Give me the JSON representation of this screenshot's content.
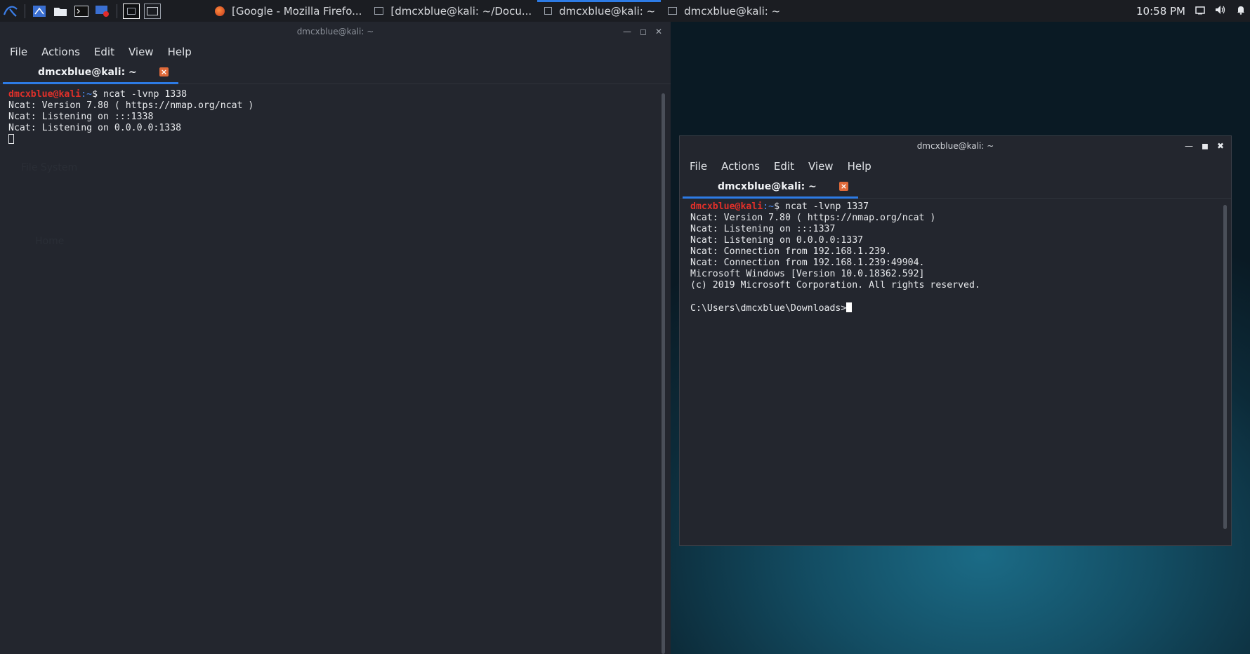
{
  "taskbar": {
    "tasks": [
      {
        "label": "[Google - Mozilla Firefo...",
        "icon": "firefox-icon"
      },
      {
        "label": "[dmcxblue@kali: ~/Docu...",
        "icon": "terminal-window-icon"
      },
      {
        "label": "dmcxblue@kali: ~",
        "icon": "terminal-window-icon",
        "active": true
      },
      {
        "label": "dmcxblue@kali: ~",
        "icon": "terminal-window-icon"
      }
    ],
    "clock": "10:58 PM"
  },
  "desktop": {
    "icons": [
      "File System",
      "Home"
    ]
  },
  "left_window": {
    "title": "dmcxblue@kali: ~",
    "menu": [
      "File",
      "Actions",
      "Edit",
      "View",
      "Help"
    ],
    "tab_label": "dmcxblue@kali: ~",
    "prompt_user": "dmcxblue@kali",
    "prompt_sep": ":~$ ",
    "command": "ncat -lvnp 1338",
    "output": [
      "Ncat: Version 7.80 ( https://nmap.org/ncat )",
      "Ncat: Listening on :::1338",
      "Ncat: Listening on 0.0.0.0:1338"
    ]
  },
  "right_window": {
    "title": "dmcxblue@kali: ~",
    "menu": [
      "File",
      "Actions",
      "Edit",
      "View",
      "Help"
    ],
    "tab_label": "dmcxblue@kali: ~",
    "prompt_user": "dmcxblue@kali",
    "prompt_sep": ":~$ ",
    "command": "ncat -lvnp 1337",
    "output": [
      "Ncat: Version 7.80 ( https://nmap.org/ncat )",
      "Ncat: Listening on :::1337",
      "Ncat: Listening on 0.0.0.0:1337",
      "Ncat: Connection from 192.168.1.239.",
      "Ncat: Connection from 192.168.1.239:49904.",
      "Microsoft Windows [Version 10.0.18362.592]",
      "(c) 2019 Microsoft Corporation. All rights reserved.",
      ""
    ],
    "windows_prompt": "C:\\Users\\dmcxblue\\Downloads>"
  }
}
